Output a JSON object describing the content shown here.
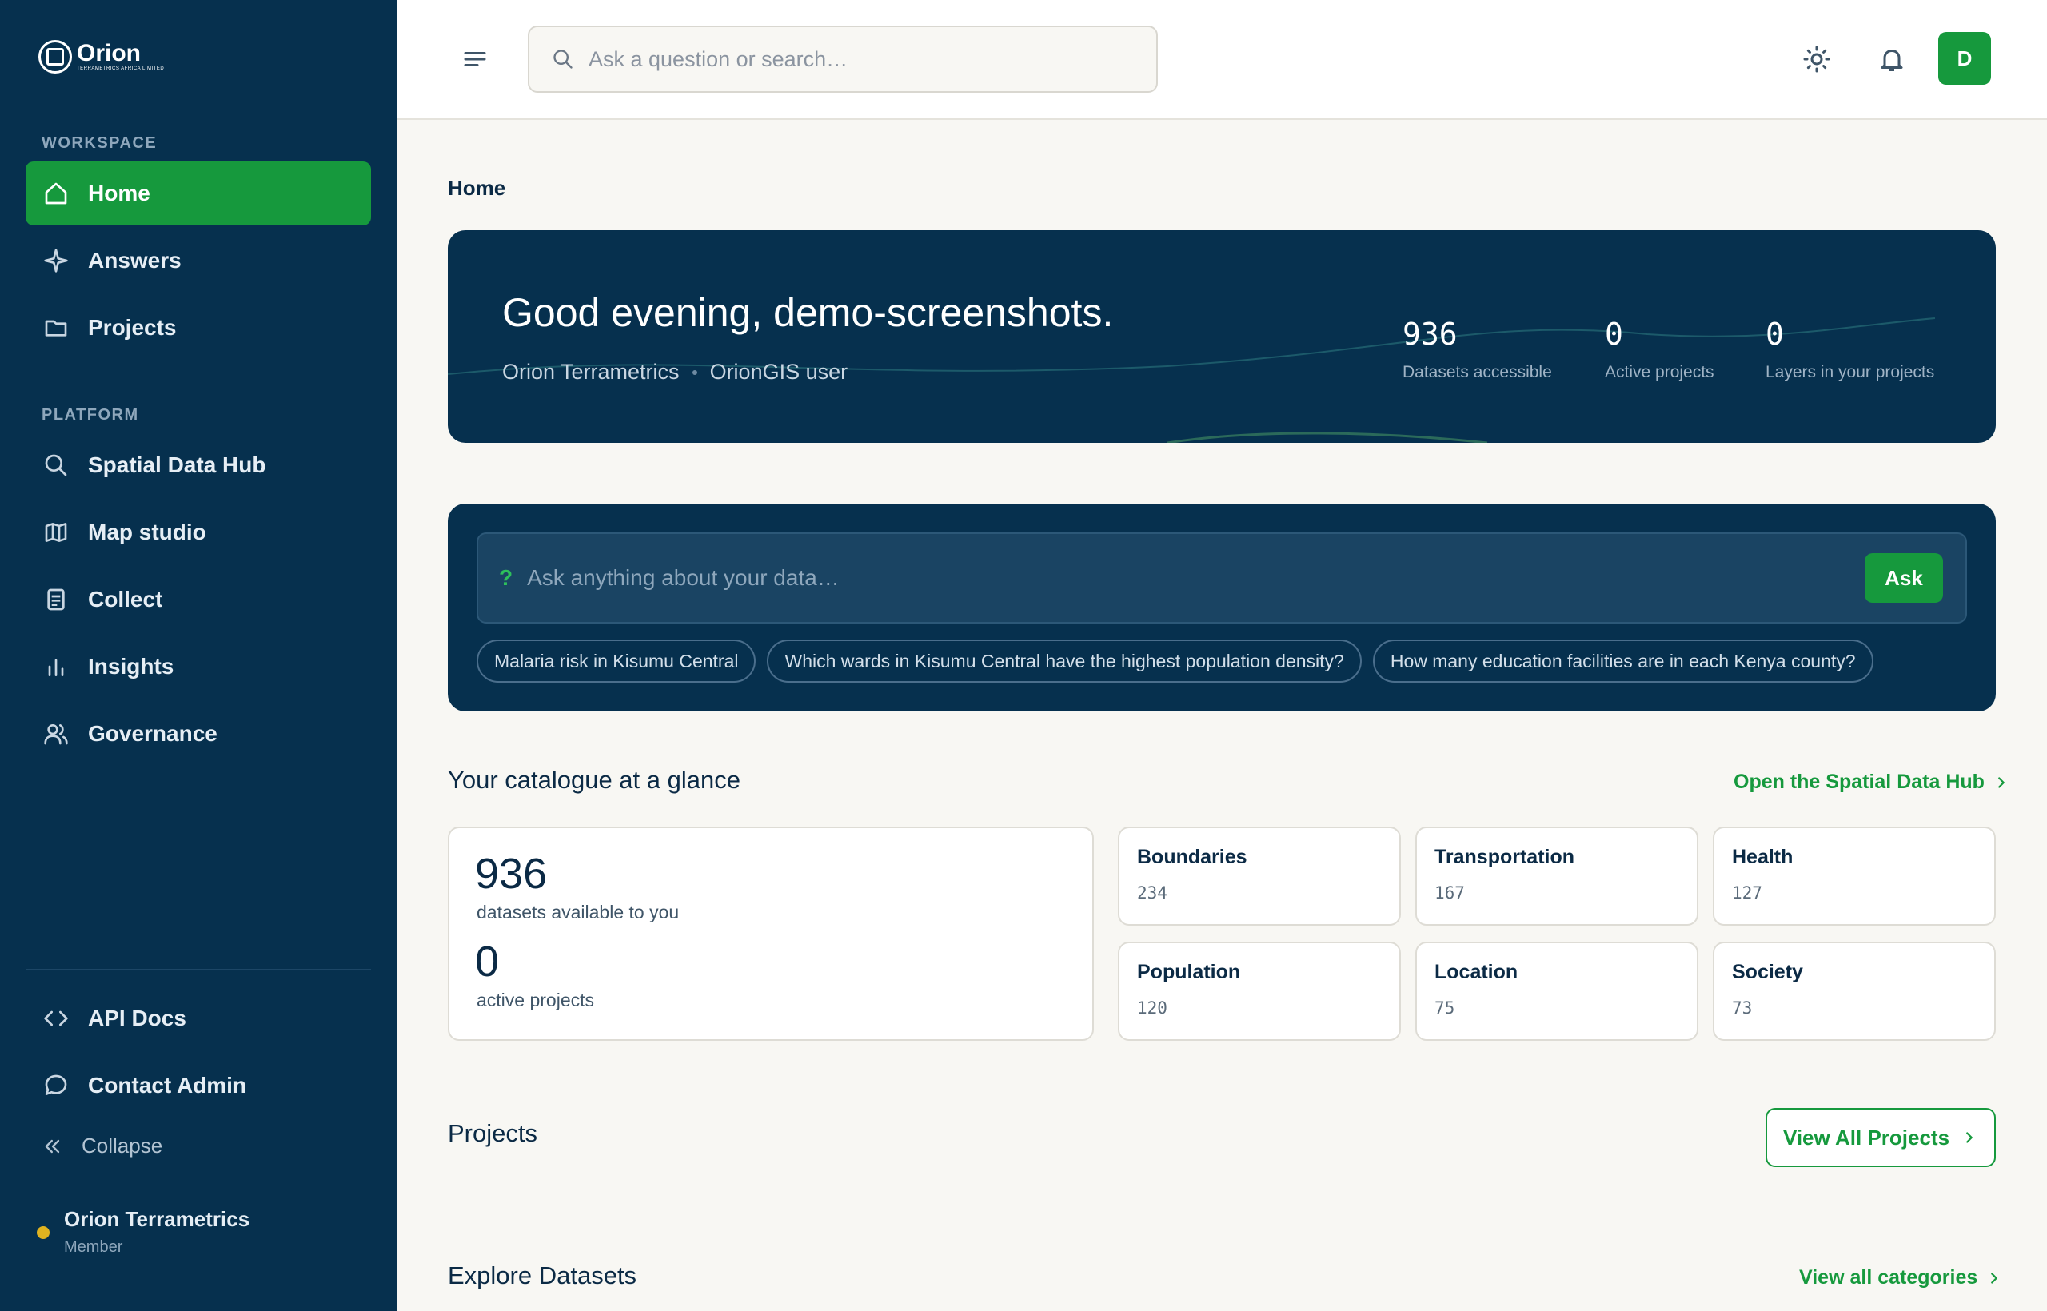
{
  "brand": {
    "name": "Orion",
    "sub": "TERRAMETRICS AFRICA LIMITED"
  },
  "sidebar": {
    "workspace_label": "WORKSPACE",
    "platform_label": "PLATFORM",
    "workspace_items": [
      {
        "label": "Home",
        "icon": "home-icon",
        "active": true
      },
      {
        "label": "Answers",
        "icon": "sparkle-icon"
      },
      {
        "label": "Projects",
        "icon": "folder-icon"
      }
    ],
    "platform_items": [
      {
        "label": "Spatial Data Hub",
        "icon": "search-icon"
      },
      {
        "label": "Map studio",
        "icon": "map-icon"
      },
      {
        "label": "Collect",
        "icon": "clipboard-icon"
      },
      {
        "label": "Insights",
        "icon": "bar-chart-icon"
      },
      {
        "label": "Governance",
        "icon": "users-icon"
      }
    ],
    "bottom_items": [
      {
        "label": "API Docs",
        "icon": "code-icon"
      },
      {
        "label": "Contact Admin",
        "icon": "chat-icon"
      }
    ],
    "collapse_label": "Collapse",
    "org_name": "Orion Terrametrics",
    "org_role": "Member"
  },
  "topbar": {
    "search_placeholder": "Ask a question or search…",
    "avatar_initial": "D"
  },
  "breadcrumb": "Home",
  "hero": {
    "greeting": "Good evening, demo-screenshots.",
    "org": "Orion Terrametrics",
    "role": "OrionGIS user",
    "stats": [
      {
        "value": "936",
        "label": "Datasets accessible"
      },
      {
        "value": "0",
        "label": "Active projects"
      },
      {
        "value": "0",
        "label": "Layers in your projects"
      }
    ]
  },
  "ask": {
    "placeholder": "Ask anything about your data…",
    "button": "Ask",
    "suggestions": [
      "Malaria risk in Kisumu Central",
      "Which wards in Kisumu Central have the highest population density?",
      "How many education facilities are in each Kenya county?"
    ]
  },
  "catalogue": {
    "title": "Your catalogue at a glance",
    "link": "Open the Spatial Data Hub",
    "datasets_count": "936",
    "datasets_label": "datasets available to you",
    "projects_count": "0",
    "projects_label": "active projects",
    "categories": [
      {
        "name": "Boundaries",
        "count": "234"
      },
      {
        "name": "Transportation",
        "count": "167"
      },
      {
        "name": "Health",
        "count": "127"
      },
      {
        "name": "Population",
        "count": "120"
      },
      {
        "name": "Location",
        "count": "75"
      },
      {
        "name": "Society",
        "count": "73"
      }
    ]
  },
  "projects": {
    "title": "Projects",
    "button": "View All Projects"
  },
  "explore": {
    "title": "Explore Datasets",
    "link": "View all categories"
  },
  "colors": {
    "sidebar": "#06304e",
    "accent": "#16993d",
    "background": "#f8f7f3"
  }
}
